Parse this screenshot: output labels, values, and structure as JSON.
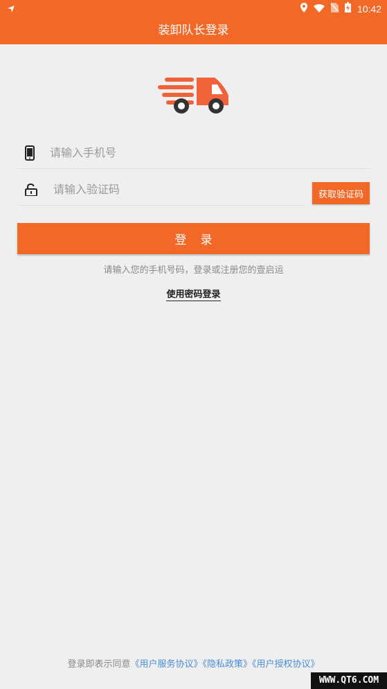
{
  "status_bar": {
    "time": "10:42",
    "icons": [
      "navigation-arrow-icon",
      "location-icon",
      "wifi-icon",
      "no-sim-icon",
      "battery-charging-icon"
    ]
  },
  "header": {
    "title": "装卸队长登录"
  },
  "logo": {
    "icon": "truck-icon",
    "color": "#f0623a"
  },
  "form": {
    "phone_placeholder": "请输入手机号",
    "phone_value": "",
    "code_placeholder": "请输入验证码",
    "code_value": "",
    "get_code_label": "获取验证码",
    "login_label": "登录",
    "hint": "请输入您的手机号码，登录或注册您的壹启运",
    "password_login_label": "使用密码登录"
  },
  "footer": {
    "prefix": "登录即表示同意",
    "links": [
      "《用户服务协议》",
      "《隐私政策》",
      "《用户授权协议》"
    ]
  },
  "watermark": "WWW.QT6.COM",
  "colors": {
    "accent": "#f26826",
    "background": "#efefef",
    "link": "#4a8ed8"
  }
}
